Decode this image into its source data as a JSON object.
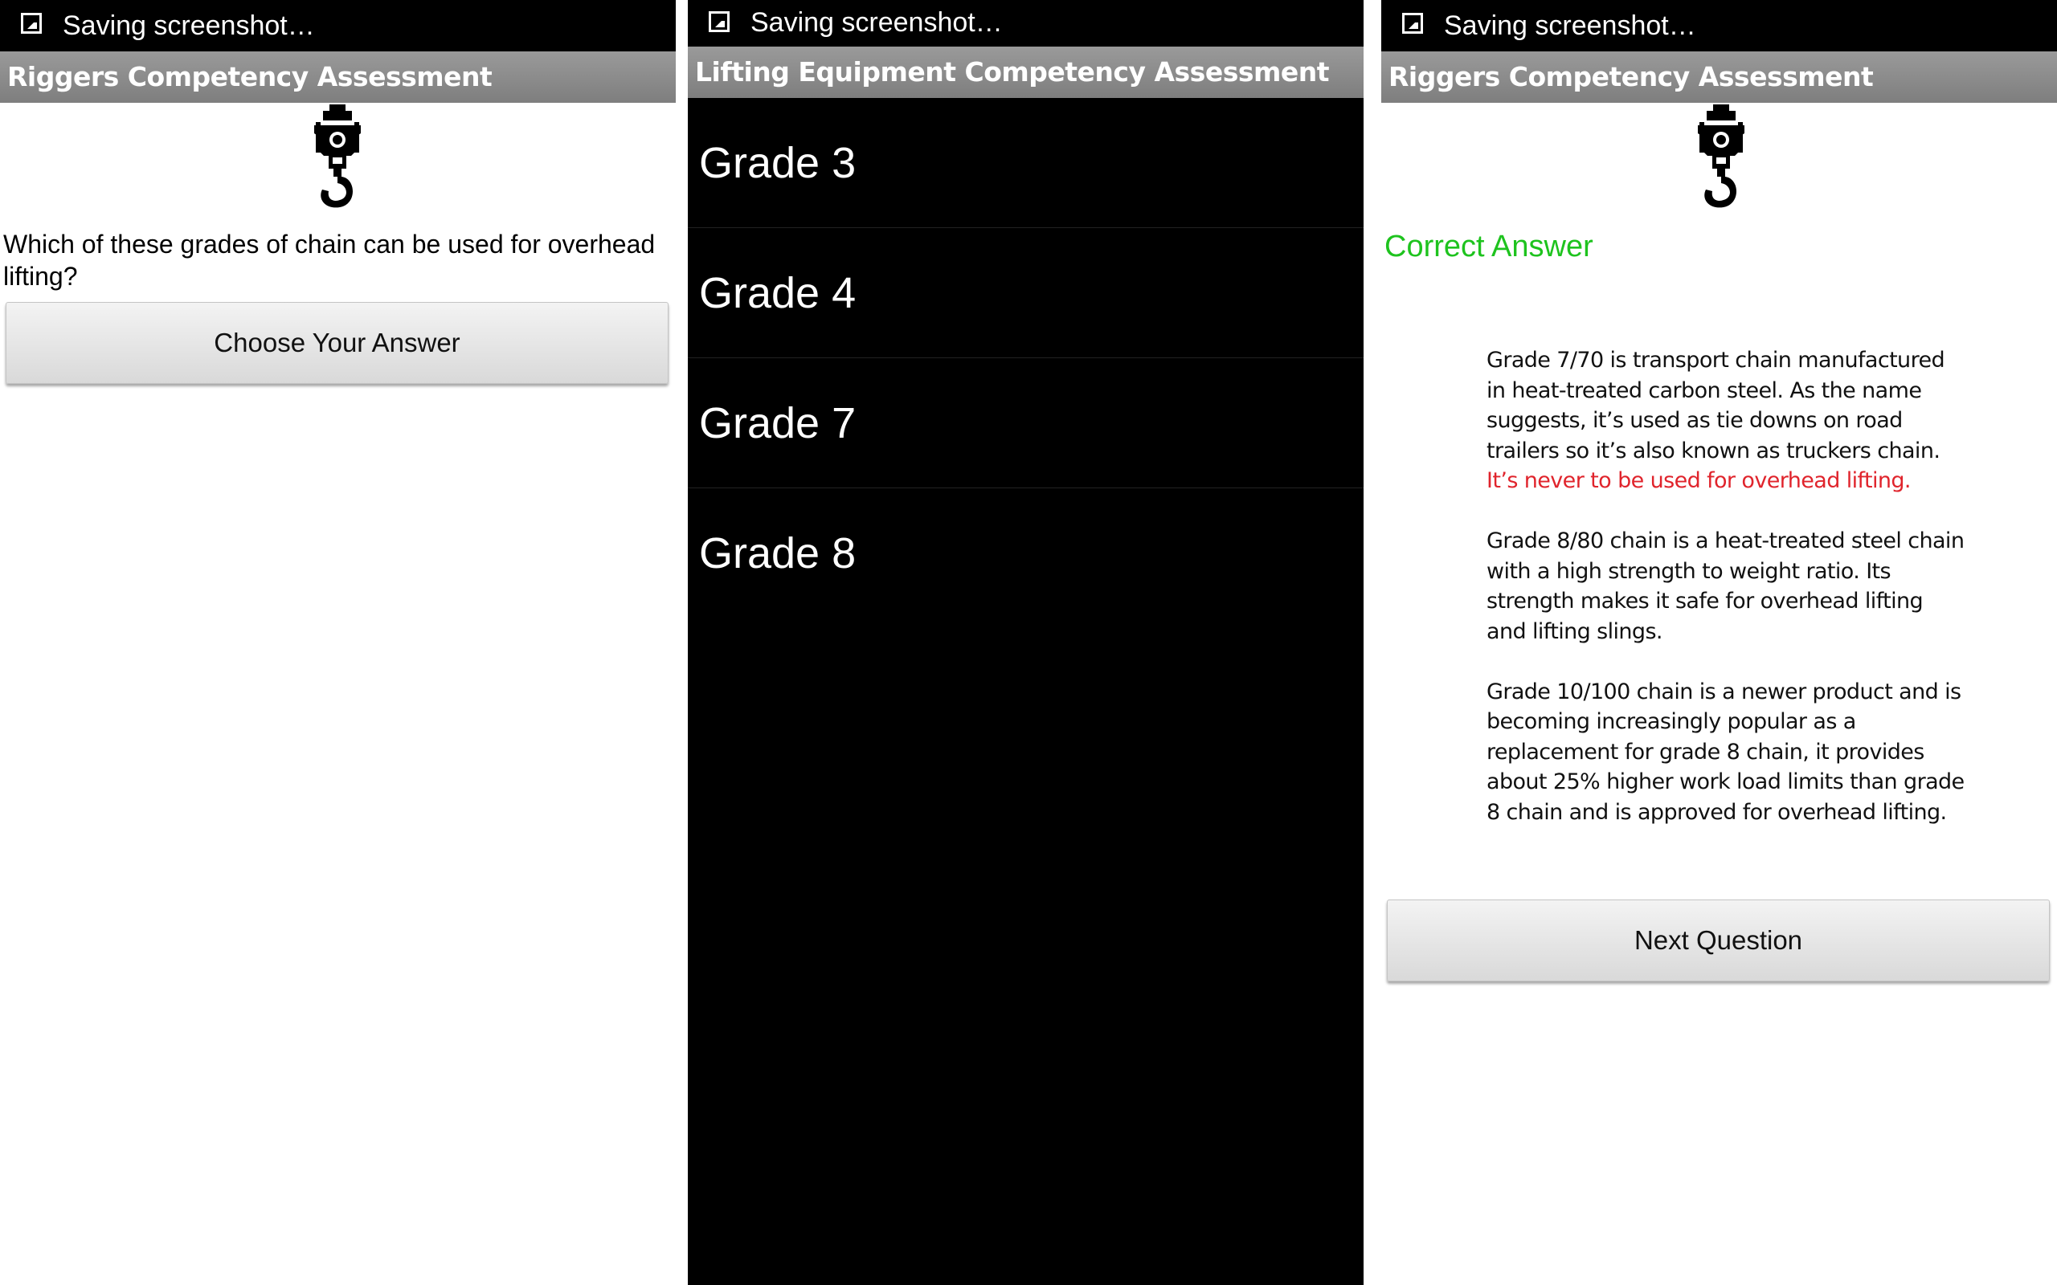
{
  "status_bar": {
    "text": "Saving screenshot…"
  },
  "screen1": {
    "title": "Riggers Competency Assessment",
    "question": "Which of these grades of chain can be used for overhead lifting?",
    "choose_button": "Choose Your Answer"
  },
  "screen2": {
    "title": "Lifting Equipment Competency Assessment",
    "options": [
      "Grade 3",
      "Grade 4",
      "Grade 7",
      "Grade 8"
    ]
  },
  "screen3": {
    "title": "Riggers Competency Assessment",
    "result": "Correct Answer",
    "explanation": {
      "p1": "Grade 7/70 is transport chain manufactured in heat-treated carbon steel. As the name suggests, it’s used as tie downs on road trailers so it’s also known as truckers chain.",
      "p1_warning": "It’s never to be used for overhead lifting.",
      "p2": "Grade 8/80 chain is a heat-treated steel chain with a high strength to weight ratio. Its strength makes it safe for overhead lifting and lifting slings.",
      "p3": "Grade 10/100 chain is a newer product and is becoming increasingly popular as a replacement for grade 8 chain, it provides about 25% higher work load limits than grade 8 chain and is approved for overhead lifting."
    },
    "next_button": "Next Question"
  },
  "colors": {
    "correct": "#1ec31e",
    "warning": "#e0242c",
    "titlebar": "#8c8c8c"
  },
  "icons": {
    "status": "screenshot-image-icon",
    "logo": "crane-hook-icon"
  }
}
